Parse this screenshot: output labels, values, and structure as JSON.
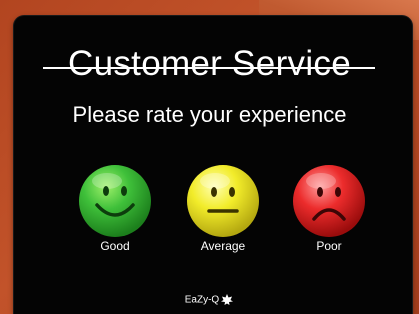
{
  "header": {
    "title": "Customer Service",
    "subtitle": "Please rate your experience"
  },
  "ratings": [
    {
      "label": "Good",
      "color": "#2db02d",
      "mood": "happy"
    },
    {
      "label": "Average",
      "color": "#e8e020",
      "mood": "neutral"
    },
    {
      "label": "Poor",
      "color": "#e02424",
      "mood": "sad"
    }
  ],
  "footer": {
    "brand": "EaZy-Q"
  }
}
